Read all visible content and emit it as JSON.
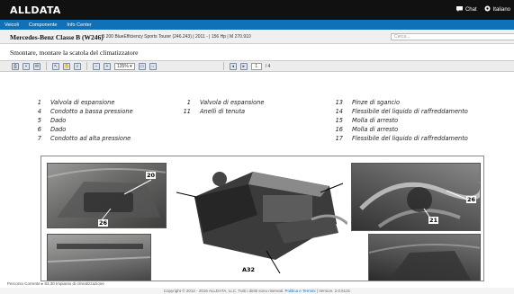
{
  "header": {
    "logo": "ALLDATA",
    "chat_label": "Chat",
    "language_label": "Italiano"
  },
  "nav": {
    "items": [
      "Veicoli",
      "Componente",
      "Info Center"
    ]
  },
  "vehicle": {
    "name": "Mercedes-Benz Classe B (W246)",
    "details": "B 200 BlueEfficiency Sports Tourer (246.243) | 2011 - | 156 Hp | M 270.910",
    "search_placeholder": "Cerca..."
  },
  "procedure": {
    "title": "Smontare, montare la scatola del climatizzatore"
  },
  "toolbar": {
    "zoom_value": "135%",
    "page_current": "1",
    "page_total": "/ 4"
  },
  "parts": [
    {
      "num": "1",
      "label": "Valvola di espansione"
    },
    {
      "num": "4",
      "label": "Condotto a bassa pressione"
    },
    {
      "num": "5",
      "label": "Dado"
    },
    {
      "num": "6",
      "label": "Dado"
    },
    {
      "num": "7",
      "label": "Condotto ad alta pressione"
    },
    {
      "num": "1",
      "label": "Valvola di espansione"
    },
    {
      "num": "11",
      "label": "Anelli di tenuta"
    },
    {
      "num": "13",
      "label": "Pinze di sgancio"
    },
    {
      "num": "14",
      "label": "Flessibile del liquido di raffreddamento"
    },
    {
      "num": "15",
      "label": "Molla di arresto"
    },
    {
      "num": "16",
      "label": "Molla di arresto"
    },
    {
      "num": "17",
      "label": "Flessibile del liquido di raffreddamento"
    }
  ],
  "figure": {
    "callouts": [
      "20",
      "26",
      "A32",
      "26",
      "21"
    ]
  },
  "status": {
    "breadcrumb": "Percorso Corrente ▸ 83.30 Impianto di climatizzazione"
  },
  "footer": {
    "copyright": "Copyright © 2012 - 2016 ALLDATA, LLC. Tutti i diritti sono riservati.",
    "policy_link": "Politica e Termini",
    "version": "| Version: 2.0.5131"
  },
  "colors": {
    "header_bg": "#111111",
    "nav_bg": "#0f72b8"
  },
  "icons": [
    "chat-icon",
    "settings-icon",
    "print-icon",
    "save-icon",
    "email-icon",
    "select-icon",
    "pan-icon",
    "zoom-icon",
    "zoom-out-icon",
    "zoom-in-icon",
    "fit-page-icon",
    "fit-width-icon",
    "prev-page-icon",
    "next-page-icon"
  ]
}
